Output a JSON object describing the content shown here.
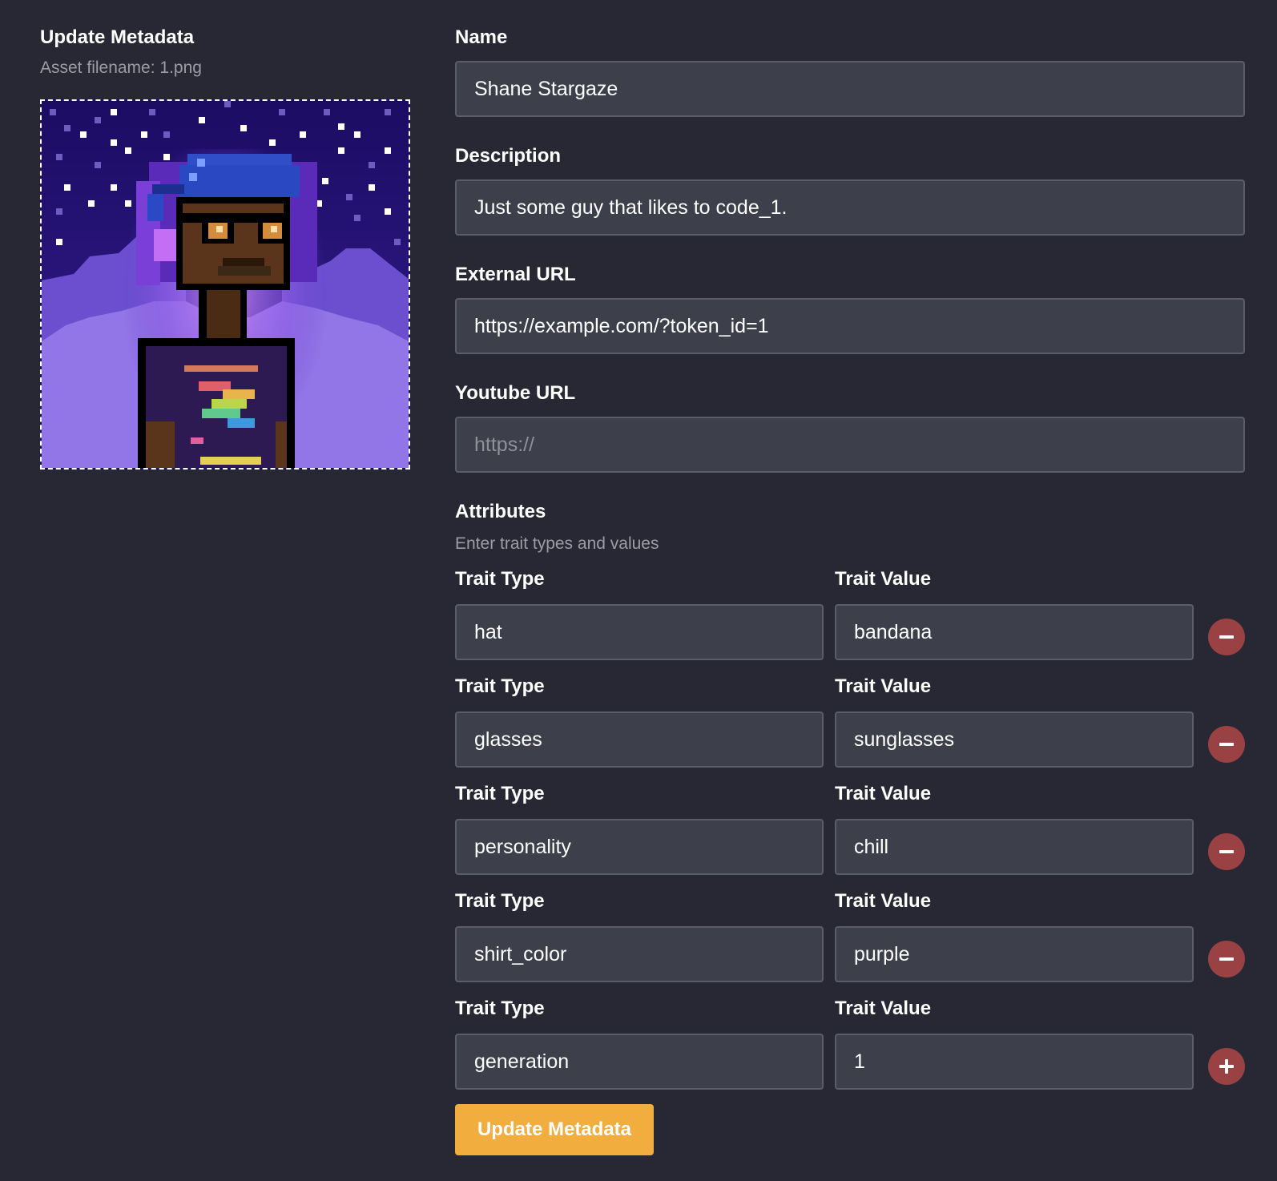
{
  "left": {
    "title": "Update Metadata",
    "subtitle": "Asset filename: 1.png"
  },
  "form": {
    "name": {
      "label": "Name",
      "value": "Shane Stargaze"
    },
    "description": {
      "label": "Description",
      "value": "Just some guy that likes to code_1."
    },
    "external_url": {
      "label": "External URL",
      "value": "https://example.com/?token_id=1"
    },
    "youtube_url": {
      "label": "Youtube URL",
      "value": "",
      "placeholder": "https://"
    }
  },
  "attributes": {
    "title": "Attributes",
    "help": "Enter trait types and values",
    "trait_type_label": "Trait Type",
    "trait_value_label": "Trait Value",
    "traits": [
      {
        "type": "hat",
        "value": "bandana",
        "action": "remove-icon"
      },
      {
        "type": "glasses",
        "value": "sunglasses",
        "action": "remove-icon"
      },
      {
        "type": "personality",
        "value": "chill",
        "action": "remove-icon"
      },
      {
        "type": "shirt_color",
        "value": "purple",
        "action": "remove-icon"
      },
      {
        "type": "generation",
        "value": "1",
        "action": "add-icon"
      }
    ]
  },
  "submit_label": "Update Metadata",
  "colors": {
    "background": "#272833",
    "input_background": "#3d3f4a",
    "input_border": "#5b5d68",
    "remove_button": "#9a4144",
    "submit_button": "#f1ad3e",
    "muted_text": "#9b9ca6"
  }
}
